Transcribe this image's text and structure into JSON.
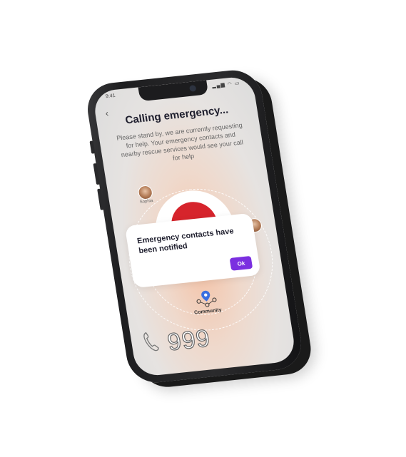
{
  "status_bar": {
    "time": "9:41",
    "icons": "▂▄▆ ◠ ▭"
  },
  "header": {
    "back_icon": "‹",
    "title": "Calling emergency...",
    "subtitle": "Please stand by, we are currently requesting for help. Your emergency contacts and nearby rescue services would see your call for help"
  },
  "contacts": [
    {
      "name": "Sophia"
    }
  ],
  "dialog": {
    "message": "Emergency contacts have been notified",
    "ok_label": "Ok"
  },
  "community": {
    "label": "Community"
  },
  "emergency_number": "999",
  "colors": {
    "accent": "#7b2fe0",
    "sos_red": "#d6242c"
  }
}
